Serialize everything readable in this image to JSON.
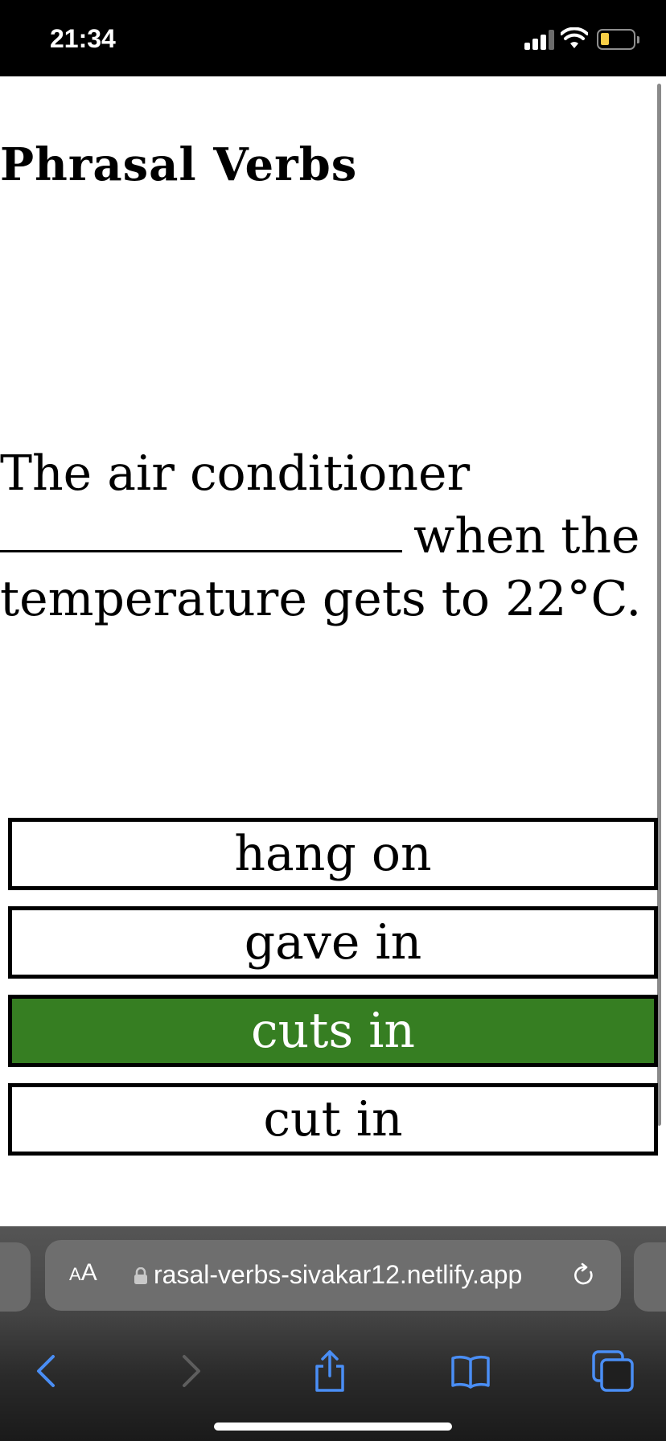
{
  "status_bar": {
    "time": "21:34"
  },
  "page": {
    "title": "Phrasal Verbs",
    "question": {
      "line1": "The air conditioner",
      "line2_after_blank": "when the",
      "line3": "temperature gets to 22°C."
    },
    "options": [
      {
        "label": "hang on",
        "selected": false
      },
      {
        "label": "gave in",
        "selected": false
      },
      {
        "label": "cuts in",
        "selected": true
      },
      {
        "label": "cut in",
        "selected": false
      }
    ]
  },
  "browser": {
    "aa_label_big": "A",
    "aa_label_small": "A",
    "url": "rasal-verbs-sivakar12.netlify.app",
    "toolbar": [
      "back-icon",
      "forward-icon",
      "share-icon",
      "bookmarks-icon",
      "tabs-icon"
    ]
  },
  "colors": {
    "selected_option": "#367e22",
    "toolbar_icon_active": "#4a8ef5",
    "toolbar_icon_disabled": "#5e5e5e"
  }
}
